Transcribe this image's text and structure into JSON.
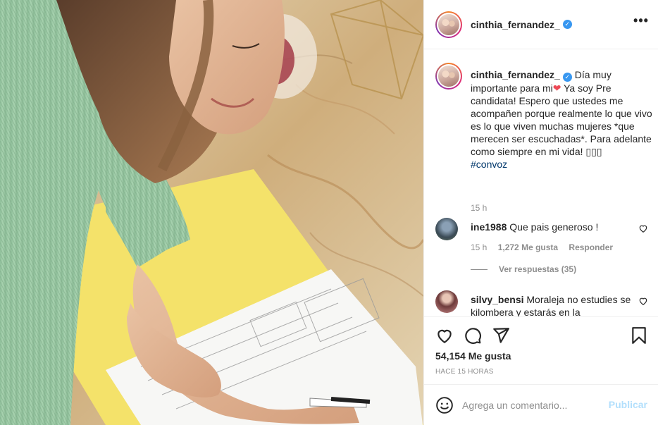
{
  "post": {
    "username": "cinthia_fernandez_",
    "verified_mark": "✓",
    "more_icon": "more-horizontal-icon",
    "more_label": "•••"
  },
  "caption": {
    "username": "cinthia_fernandez_",
    "text_part1": "Día muy importante para mi",
    "heart": "❤",
    "text_part2": " Ya soy Pre candidata! Espero que ustedes me acompañen porque realmente lo que vivo es lo que viven muchas mujeres *que merecen ser escuchadas*. Para adelante como siempre en mi vida! ",
    "boxes": "▯▯▯",
    "hashtag": "#convoz",
    "time": "15 h"
  },
  "comments": [
    {
      "username": "ine1988",
      "text": "Que pais generoso !",
      "time": "15 h",
      "likes": "1,272 Me gusta",
      "reply": "Responder",
      "view_replies": "Ver respuestas (35)"
    },
    {
      "username": "silvy_bensi",
      "text": "Moraleja no estudies se kilombera y estarás en la"
    }
  ],
  "actions": {
    "like_icon": "heart-icon",
    "comment_icon": "comment-icon",
    "share_icon": "share-icon",
    "save_icon": "bookmark-icon",
    "likes": "54,154 Me gusta",
    "posted_ago": "HACE 15 HORAS"
  },
  "add_comment": {
    "emoji_icon": "emoji-icon",
    "placeholder": "Agrega un comentario...",
    "publish": "Publicar"
  },
  "colors": {
    "text": "#262626",
    "muted": "#8e8e8e",
    "link": "#00376b",
    "verified": "#3897f0",
    "publish_disabled": "#b2dffc",
    "heart": "#ed4956"
  }
}
